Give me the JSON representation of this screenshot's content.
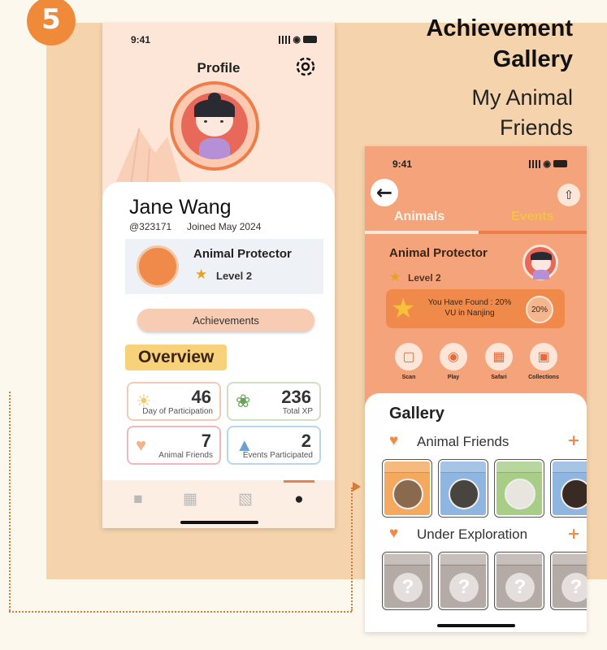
{
  "step_number": "5",
  "headline": {
    "title": "Achievement Gallery",
    "subtitle": "My Animal Friends"
  },
  "colors": {
    "accent": "#ef7d4a",
    "background": "#f5d3ad",
    "page": "#fcf8ee"
  },
  "profile_screen": {
    "status_time": "9:41",
    "title": "Profile",
    "settings_icon": "gear-icon",
    "user": {
      "name": "Jane Wang",
      "id": "@323171",
      "joined": "Joined May 2024"
    },
    "badge": {
      "title": "Animal Protector",
      "level": "Level 2"
    },
    "achievements_button": "Achievements",
    "overview_label": "Overview",
    "stats": [
      {
        "value": "46",
        "label": "Day of Participation",
        "icon": "sun-icon"
      },
      {
        "value": "236",
        "label": "Total XP",
        "icon": "leaf-icon"
      },
      {
        "value": "7",
        "label": "Animal Friends",
        "icon": "heart-icon"
      },
      {
        "value": "2",
        "label": "Events Participated",
        "icon": "thumbs-up-icon"
      }
    ],
    "tab_bar": [
      "home-icon",
      "chat-icon",
      "calendar-icon",
      "profile-icon"
    ],
    "active_tab": "profile-icon"
  },
  "gallery_screen": {
    "status_time": "9:41",
    "tabs": [
      "Animals",
      "Events"
    ],
    "badge": {
      "title": "Animal Protector",
      "level": "Level 2"
    },
    "found": {
      "text": "You Have Found : 20% VU in Nanjing",
      "percent": "20%"
    },
    "actions": [
      {
        "label": "Scan",
        "icon": "camera-icon"
      },
      {
        "label": "Play",
        "icon": "gamepad-icon"
      },
      {
        "label": "Safari",
        "icon": "calendar-icon"
      },
      {
        "label": "Collections",
        "icon": "book-icon"
      }
    ],
    "gallery_title": "Gallery",
    "sections": [
      {
        "title": "Animal Friends",
        "cards": [
          "#f4a95e",
          "#8fb6e0",
          "#a7cd86",
          "#8fb6e0"
        ]
      },
      {
        "title": "Under Exploration",
        "cards": [
          "?",
          "?",
          "?",
          "?"
        ]
      }
    ]
  }
}
